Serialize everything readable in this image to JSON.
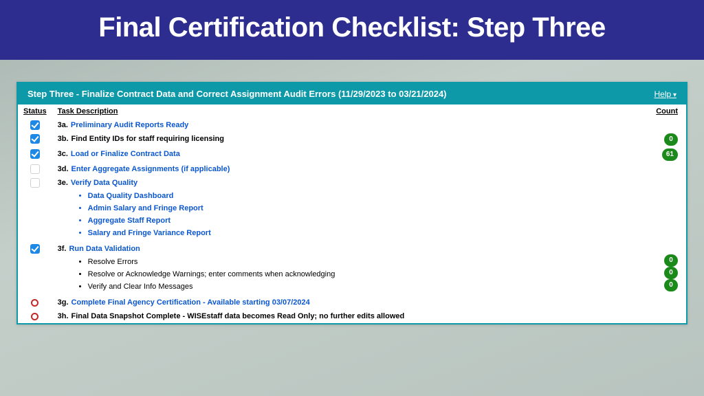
{
  "banner": "Final Certification Checklist: Step Three",
  "panel": {
    "title": "Step Three - Finalize Contract Data and Correct Assignment Audit Errors (11/29/2023 to 03/21/2024)",
    "help": "Help"
  },
  "headers": {
    "status": "Status",
    "desc": "Task Description",
    "count": "Count"
  },
  "rows": {
    "a": {
      "prefix": "3a.",
      "label": "Preliminary Audit Reports Ready"
    },
    "b": {
      "prefix": "3b.",
      "label": "Find Entity IDs for staff requiring licensing",
      "count": "0"
    },
    "c": {
      "prefix": "3c.",
      "label": "Load or Finalize Contract Data",
      "count": "61"
    },
    "d": {
      "prefix": "3d.",
      "label": "Enter Aggregate Assignments (if applicable)"
    },
    "e": {
      "prefix": "3e.",
      "label": "Verify Data Quality",
      "subs": {
        "s1": "Data Quality Dashboard",
        "s2": "Admin Salary and Fringe Report",
        "s3": "Aggregate Staff Report",
        "s4": "Salary and Fringe Variance Report"
      }
    },
    "f": {
      "prefix": "3f.",
      "label": "Run Data Validation",
      "subs": {
        "s1": "Resolve Errors",
        "s2": "Resolve or Acknowledge Warnings; enter comments when acknowledging",
        "s3": "Verify and Clear Info Messages"
      },
      "counts": {
        "c1": "0",
        "c2": "0",
        "c3": "0"
      }
    },
    "g": {
      "prefix": "3g.",
      "label": "Complete Final Agency Certification - Available starting 03/07/2024"
    },
    "h": {
      "prefix": "3h.",
      "label": "Final Data Snapshot Complete - WISEstaff data becomes Read Only; no further edits allowed"
    }
  }
}
